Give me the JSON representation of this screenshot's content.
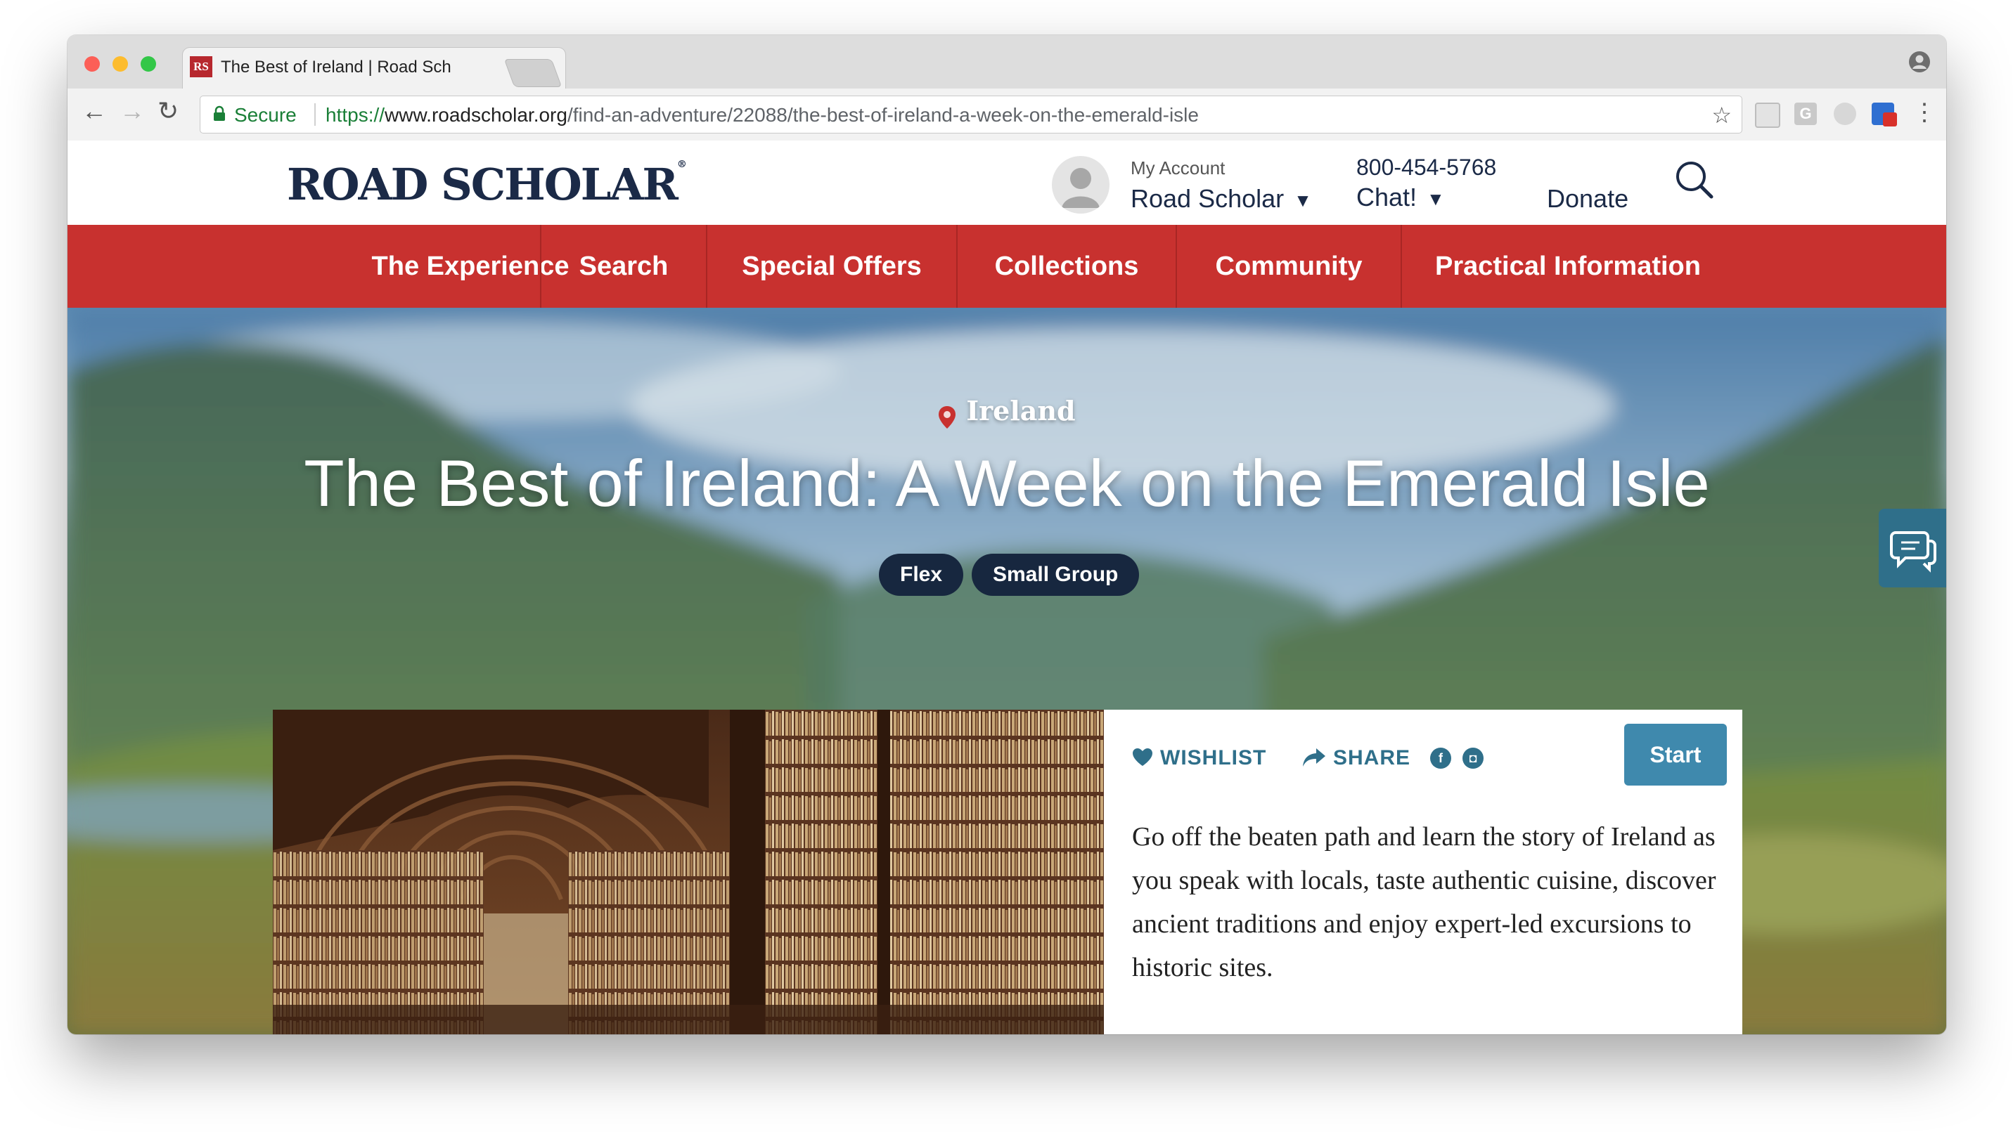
{
  "browser": {
    "tab_title": "The Best of Ireland | Road Sch",
    "tab_favicon": "RS",
    "tab_close": "×",
    "secure_label": "Secure",
    "url_scheme": "https://",
    "url_host": "www.roadscholar.org",
    "url_path": "/find-an-adventure/22088/the-best-of-ireland-a-week-on-the-emerald-isle",
    "back_glyph": "←",
    "forward_glyph": "→",
    "reload_glyph": "↻",
    "star_glyph": "☆",
    "menu_glyph": "⋮",
    "traffic_colors": [
      "#fc5f57",
      "#fdbc2e",
      "#33c748"
    ]
  },
  "header": {
    "logo": "ROAD SCHOLAR",
    "logo_mark": "®",
    "account_label": "My Account",
    "account_name": "Road Scholar",
    "caret": "▼",
    "phone": "800-454-5768",
    "chat": "Chat!",
    "donate": "Donate"
  },
  "nav": {
    "items": [
      {
        "label": "The Experience"
      },
      {
        "label": "Search"
      },
      {
        "label": "Special Offers"
      },
      {
        "label": "Collections"
      },
      {
        "label": "Community"
      },
      {
        "label": "Practical Information"
      }
    ]
  },
  "hero": {
    "location": "Ireland",
    "title": "The Best of Ireland: A Week on the Emerald Isle",
    "tags": [
      "Flex",
      "Small Group"
    ]
  },
  "feature": {
    "wishlist": "WISHLIST",
    "share": "SHARE",
    "facebook_glyph": "f",
    "instagram_glyph": "◘",
    "start": "Start",
    "description": "Go off the beaten path and learn the story of Ireland as you speak with locals, taste authentic cuisine, discover ancient traditions and enjoy expert-led excursions to historic sites."
  },
  "icons": {
    "lock": "lock-icon",
    "star": "bookmark-star-icon",
    "avatar": "user-avatar-icon",
    "search": "search-icon",
    "pin": "location-pin-icon",
    "chat": "chat-bubbles-icon",
    "heart": "heart-icon",
    "share": "share-arrow-icon"
  },
  "colors": {
    "nav_red": "#c8312f",
    "brand_navy": "#1b2a47",
    "accent_teal": "#2f6f8a",
    "start_button": "#3f89ad",
    "pill_dark": "#17273f"
  }
}
